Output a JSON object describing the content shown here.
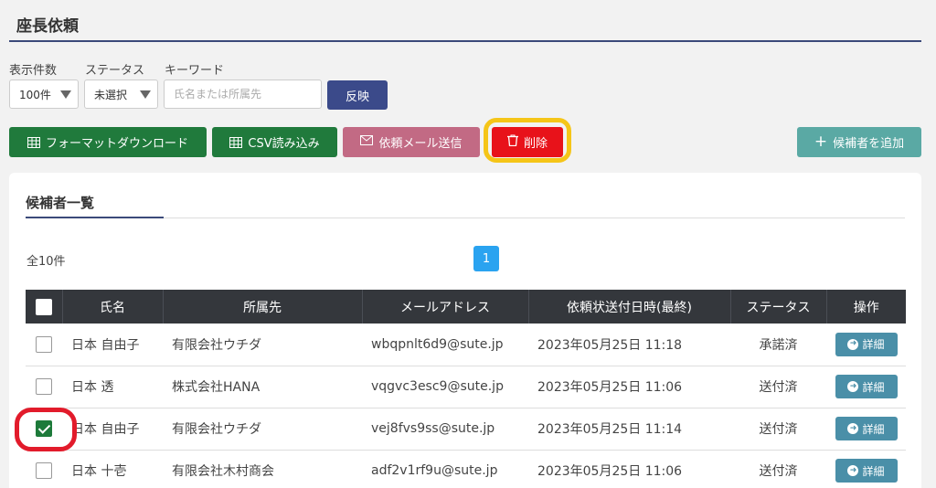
{
  "page": {
    "title": "座長依頼"
  },
  "filters": {
    "count_label": "表示件数",
    "count_value": "100件",
    "status_label": "ステータス",
    "status_value": "未選択",
    "keyword_label": "キーワード",
    "keyword_placeholder": "氏名または所属先",
    "keyword_value": "",
    "apply_label": "反映"
  },
  "toolbar": {
    "format_download_label": "フォーマットダウンロード",
    "csv_import_label": "CSV読み込み",
    "send_mail_label": "依頼メール送信",
    "delete_label": "削除",
    "add_candidate_label": "候補者を追加"
  },
  "candidates": {
    "title": "候補者一覧",
    "total_label": "全10件",
    "current_page": "1",
    "columns": [
      "氏名",
      "所属先",
      "メールアドレス",
      "依頼状送付日時(最終)",
      "ステータス",
      "操作"
    ],
    "detail_label": "詳細",
    "rows": [
      {
        "checked": false,
        "name": "日本 自由子",
        "org": "有限会社ウチダ",
        "email": "wbqpnlt6d9@sute.jp",
        "sent_at": "2023年05月25日 11:18",
        "status": "承諾済"
      },
      {
        "checked": false,
        "name": "日本 透",
        "org": "株式会社HANA",
        "email": "vqgvc3esc9@sute.jp",
        "sent_at": "2023年05月25日 11:06",
        "status": "送付済"
      },
      {
        "checked": true,
        "name": "日本 自由子",
        "org": "有限会社ウチダ",
        "email": "vej8fvs9ss@sute.jp",
        "sent_at": "2023年05月25日 11:14",
        "status": "送付済"
      },
      {
        "checked": false,
        "name": "日本 十壱",
        "org": "有限会社木村商会",
        "email": "adf2v1rf9u@sute.jp",
        "sent_at": "2023年05月25日 11:06",
        "status": "送付済"
      }
    ]
  },
  "colors": {
    "header_bg": "#34373c",
    "apply": "#3b4a8a",
    "green": "#207a3c",
    "pink": "#c26a84",
    "red": "#e8121a",
    "teal": "#5aa9a4",
    "detail": "#4a8fa8",
    "page_active": "#2aa3f0",
    "highlight_yellow": "#f5c518",
    "highlight_red": "#e21b2b"
  },
  "icons": {
    "format_download": "table-icon",
    "csv_import": "table-icon",
    "send_mail": "envelope-icon",
    "delete": "trash-icon",
    "add": "plus-icon",
    "detail": "arrow-circle-icon"
  }
}
